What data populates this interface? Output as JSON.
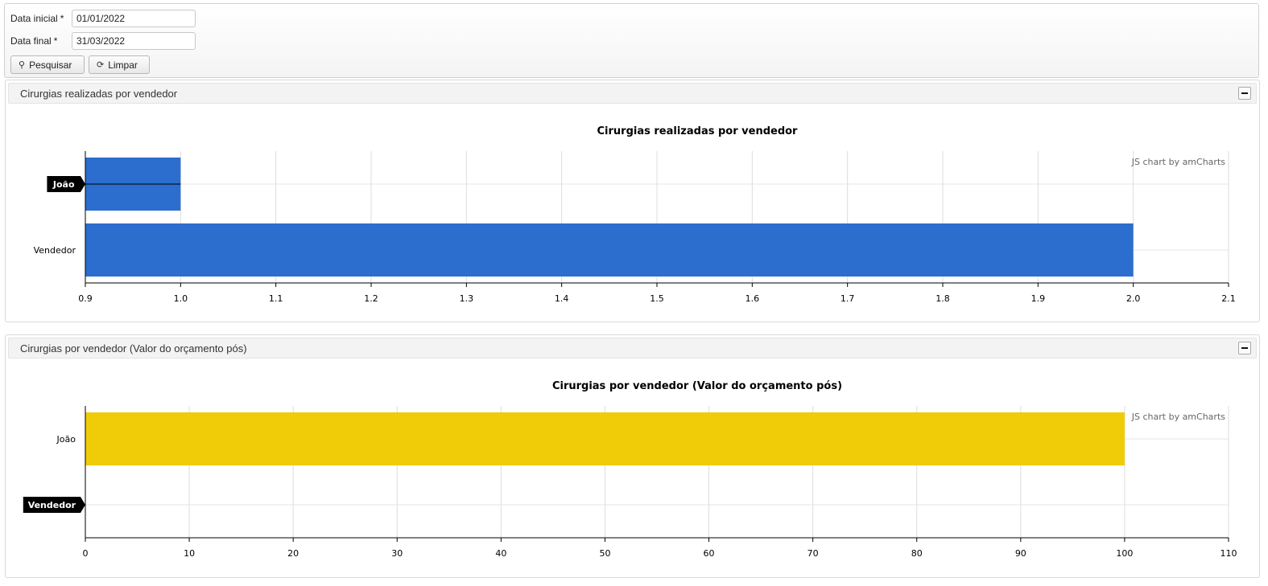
{
  "filters": {
    "start_label": "Data inicial",
    "start_value": "01/01/2022",
    "end_label": "Data final",
    "end_value": "31/03/2022",
    "required_mark": "*",
    "search_label": "Pesquisar",
    "clear_label": "Limpar",
    "search_icon": "search-icon",
    "clear_icon": "refresh-icon"
  },
  "panels": [
    {
      "header": "Cirurgias realizadas por vendedor",
      "collapse_icon": "minus-icon"
    },
    {
      "header": "Cirurgias por vendedor (Valor do orçamento pós)",
      "collapse_icon": "minus-icon"
    }
  ],
  "chart_data": [
    {
      "type": "bar",
      "orientation": "horizontal",
      "title": "Cirurgias realizadas por vendedor",
      "categories": [
        "João",
        "Vendedor"
      ],
      "values": [
        1,
        2
      ],
      "xlim": [
        0.9,
        2.1
      ],
      "xticks": [
        "0.9",
        "1.0",
        "1.1",
        "1.2",
        "1.3",
        "1.4",
        "1.5",
        "1.6",
        "1.7",
        "1.8",
        "1.9",
        "2.0",
        "2.1"
      ],
      "bar_color": "#2c6ecd",
      "grid": true,
      "highlighted_category": "João",
      "credit": "JS chart by amCharts"
    },
    {
      "type": "bar",
      "orientation": "horizontal",
      "title": "Cirurgias por vendedor (Valor do orçamento pós)",
      "categories": [
        "João",
        "Vendedor"
      ],
      "values": [
        100,
        0
      ],
      "xlim": [
        0,
        110
      ],
      "xticks": [
        "0",
        "10",
        "20",
        "30",
        "40",
        "50",
        "60",
        "70",
        "80",
        "90",
        "100",
        "110"
      ],
      "bar_color": "#f0cb08",
      "grid": true,
      "highlighted_category": "Vendedor",
      "credit": "JS chart by amCharts"
    }
  ]
}
